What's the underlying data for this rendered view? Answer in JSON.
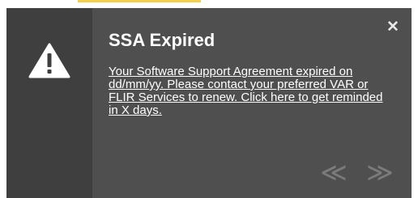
{
  "notification": {
    "title": "SSA Expired",
    "message": "Your Software Support Agreement expired on dd/mm/yy. Please contact your preferred VAR or FLIR Services to renew. Click here to get reminded in X days.",
    "close_glyph": "✕",
    "prev_glyph": "≪",
    "next_glyph": "≫",
    "icon": "warning-icon"
  },
  "colors": {
    "panel_background": "#4f4f4f",
    "icon_panel_background": "#3f3f3f",
    "text": "#ffffff",
    "nav_arrows": "#7b7b7b",
    "top_accent": "#f2d04a"
  }
}
